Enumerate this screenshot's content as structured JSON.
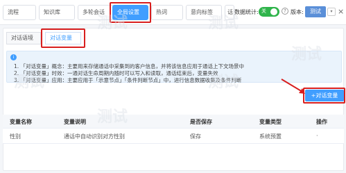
{
  "top_tabs": [
    "流程",
    "知识库",
    "多轮会话",
    "全局设置",
    "热词",
    "意向标签",
    "话"
  ],
  "stats": {
    "label": "数据统计:",
    "switch_label": "关"
  },
  "version": {
    "label": "版本:",
    "badge": "测试",
    "dropdown": "▾"
  },
  "sub_tabs": [
    "对话语境",
    "对话变量"
  ],
  "notice": {
    "lines": [
      "1. 「对话变量」概念：主要用来存储通话中采集到的客户信息，并将该信息应用于通话上下文场景中",
      "2. 「对话变量」时效：一通对话生命周期内随时可以写入和读取，通话结束后，变量失效",
      "3. 「对话变量」应用：主要应用于「示意节点」「条件判断节点」中，进行信息数据收集及条件判断"
    ]
  },
  "add_button": "+对话变量",
  "table": {
    "headers": [
      "变量名称",
      "变量说明",
      "是否保存",
      "变量类型",
      "操作"
    ],
    "rows": [
      [
        "性别",
        "通话中自动识别对方性别",
        "保存",
        "系统预置",
        "·"
      ]
    ]
  },
  "watermark": "测试",
  "colors": {
    "accent": "#409eff",
    "highlight": "#d81e1e",
    "switch_on": "#2fb44b"
  }
}
